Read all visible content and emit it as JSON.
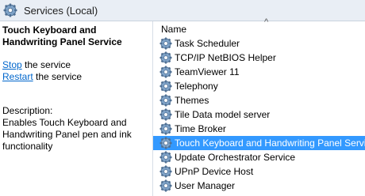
{
  "window": {
    "title": "Services (Local)"
  },
  "details": {
    "service_name": "Touch Keyboard and Handwriting Panel Service",
    "stop_link": "Stop",
    "stop_suffix": " the service",
    "restart_link": "Restart",
    "restart_suffix": " the service",
    "description_label": "Description:",
    "description_text": "Enables Touch Keyboard and Handwriting Panel pen and ink functionality"
  },
  "list": {
    "header": "Name",
    "sort_indicator": "^",
    "rows": [
      {
        "label": "Task Scheduler",
        "selected": false
      },
      {
        "label": "TCP/IP NetBIOS Helper",
        "selected": false
      },
      {
        "label": "TeamViewer 11",
        "selected": false
      },
      {
        "label": "Telephony",
        "selected": false
      },
      {
        "label": "Themes",
        "selected": false
      },
      {
        "label": "Tile Data model server",
        "selected": false
      },
      {
        "label": "Time Broker",
        "selected": false
      },
      {
        "label": "Touch Keyboard and Handwriting Panel Service",
        "selected": true
      },
      {
        "label": "Update Orchestrator Service",
        "selected": false
      },
      {
        "label": "UPnP Device Host",
        "selected": false
      },
      {
        "label": "User Manager",
        "selected": false
      }
    ]
  },
  "colors": {
    "selection": "#3399ff",
    "link": "#0066cc",
    "titlebar": "#e9eef5"
  },
  "icons": {
    "title": "services-gear-icon",
    "row": "service-gear-icon"
  }
}
